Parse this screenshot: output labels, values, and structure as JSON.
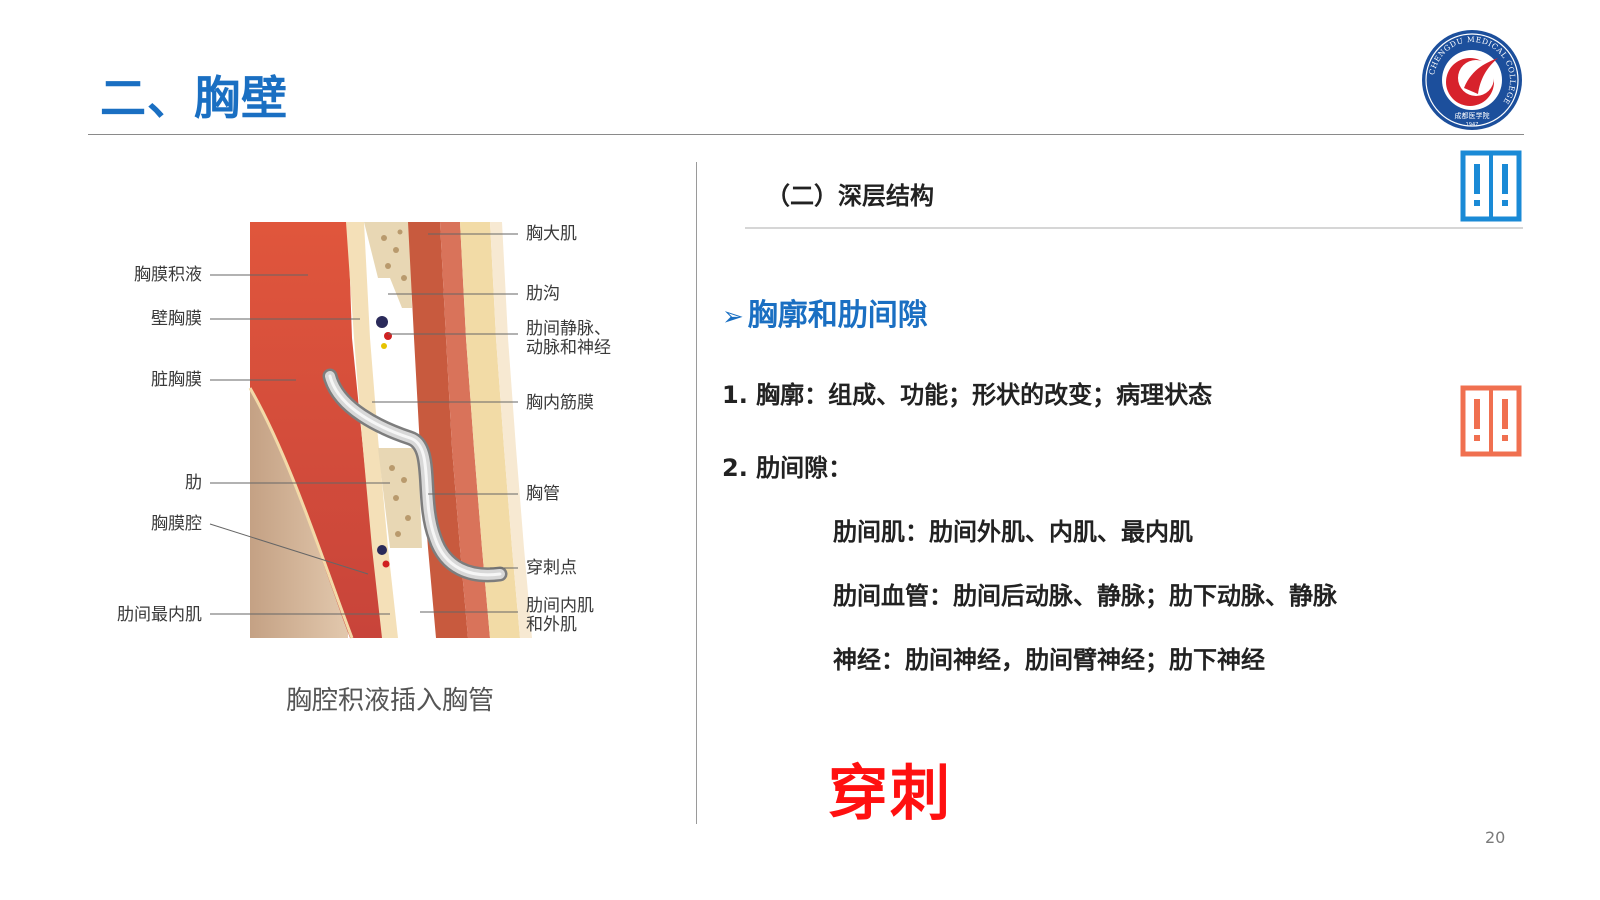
{
  "slide": {
    "title": "二、胸壁",
    "page_number": "20"
  },
  "logo": {
    "ring_text": "CHENGDU MEDICAL COLLEGE",
    "bottom_text": "成都医学院",
    "year": "1947",
    "colors": {
      "ring": "#1c4f9c",
      "red": "#d7222c"
    }
  },
  "figure": {
    "labels_left": [
      "胸膜积液",
      "壁胸膜",
      "脏胸膜",
      "肋",
      "胸膜腔",
      "肋间最内肌"
    ],
    "labels_right": [
      "胸大肌",
      "肋沟",
      "肋间静脉、",
      "动脉和神经",
      "胸内筋膜",
      "胸管",
      "穿刺点",
      "肋间内肌",
      "和外肌"
    ],
    "caption": "胸腔积液插入胸管"
  },
  "content": {
    "section_subtitle": "（二）深层结构",
    "topic": "胸廓和肋间隙",
    "topic_marker": "➢",
    "item1": "1. 胸廓：组成、功能；形状的改变；病理状态",
    "item2": "2. 肋间隙：",
    "sub_items": [
      "肋间肌：肋间外肌、内肌、最内肌",
      "肋间血管：肋间后动脉、静脉；肋下动脉、静脉",
      "神经：肋间神经，肋间臂神经；肋下神经"
    ],
    "emphasis": "穿刺"
  },
  "icons": {
    "note_icon_top": {
      "name": "exclamation-pair-icon",
      "color": "#1a8ad6"
    },
    "note_icon_bottom": {
      "name": "exclamation-pair-icon",
      "color": "#f07050"
    }
  },
  "colors": {
    "accent_blue": "#1a6fc2",
    "emphasis_red": "#ff1010"
  }
}
